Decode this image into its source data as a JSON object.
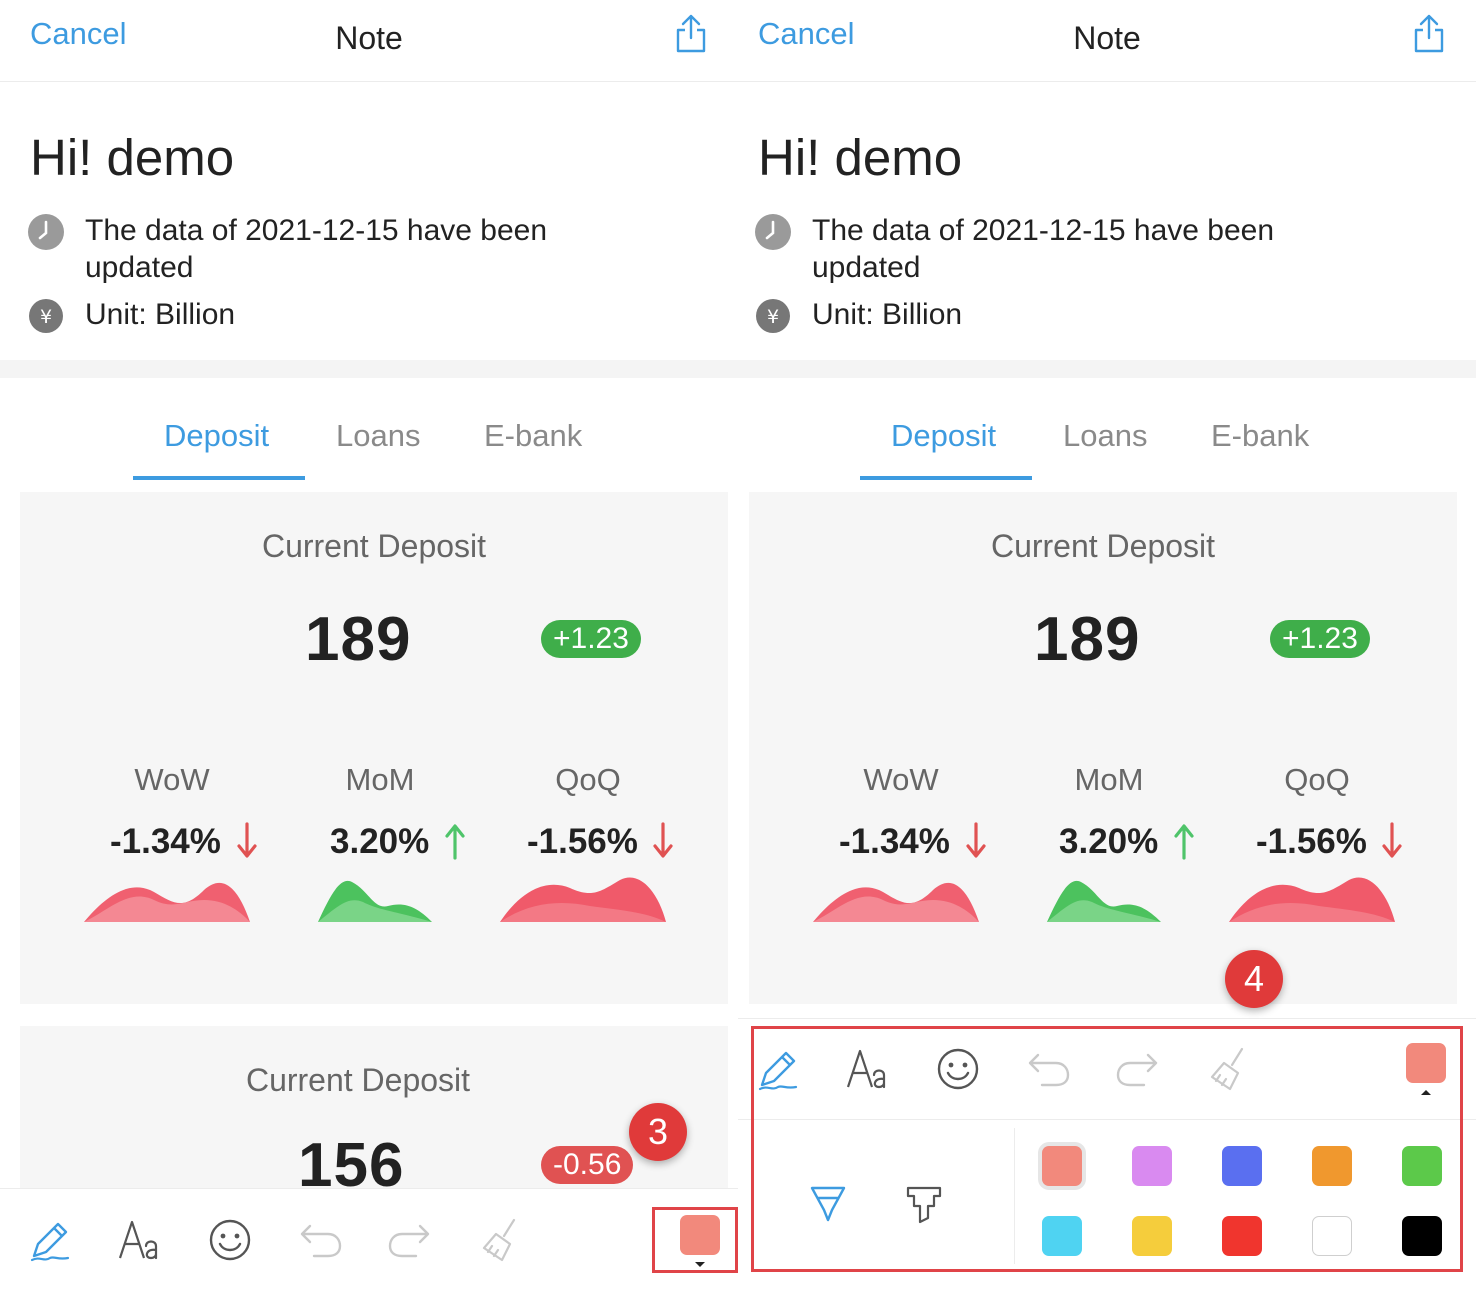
{
  "nav": {
    "cancel": "Cancel",
    "title": "Note",
    "share_icon": "share-icon"
  },
  "header": {
    "greeting": "Hi! demo",
    "updated_text": "The data of 2021-12-15 have been updated",
    "unit_text": "Unit: Billion",
    "clock_icon": "clock-icon",
    "currency_icon": "yen-icon"
  },
  "tabs": [
    {
      "label": "Deposit",
      "active": true
    },
    {
      "label": "Loans",
      "active": false
    },
    {
      "label": "E-bank",
      "active": false
    }
  ],
  "card1": {
    "title": "Current Deposit",
    "value": "189",
    "change": "+1.23",
    "metrics": [
      {
        "label": "WoW",
        "value": "-1.34%",
        "direction": "down"
      },
      {
        "label": "MoM",
        "value": "3.20%",
        "direction": "up"
      },
      {
        "label": "QoQ",
        "value": "-1.56%",
        "direction": "down"
      }
    ]
  },
  "card2": {
    "title": "Current Deposit",
    "value": "156",
    "change": "-0.56"
  },
  "toolbar": {
    "tools": [
      "pen-icon",
      "text-icon",
      "emoji-icon",
      "undo-icon",
      "redo-icon",
      "eraser-icon"
    ],
    "selected_color": "#f2897c"
  },
  "palette": {
    "pens": [
      "marker-pen-icon",
      "highlighter-pen-icon"
    ],
    "colors": [
      "#f2897c",
      "#d98af0",
      "#5a6ff0",
      "#f0982e",
      "#5cc94a",
      "#4fd3f2",
      "#f5cd3c",
      "#f0352e",
      "#ffffff",
      "#000000"
    ]
  },
  "steps": {
    "left": "3",
    "right": "4"
  },
  "colors": {
    "accent": "#3d9be0",
    "up": "#3fae4a",
    "down": "#e05252"
  }
}
